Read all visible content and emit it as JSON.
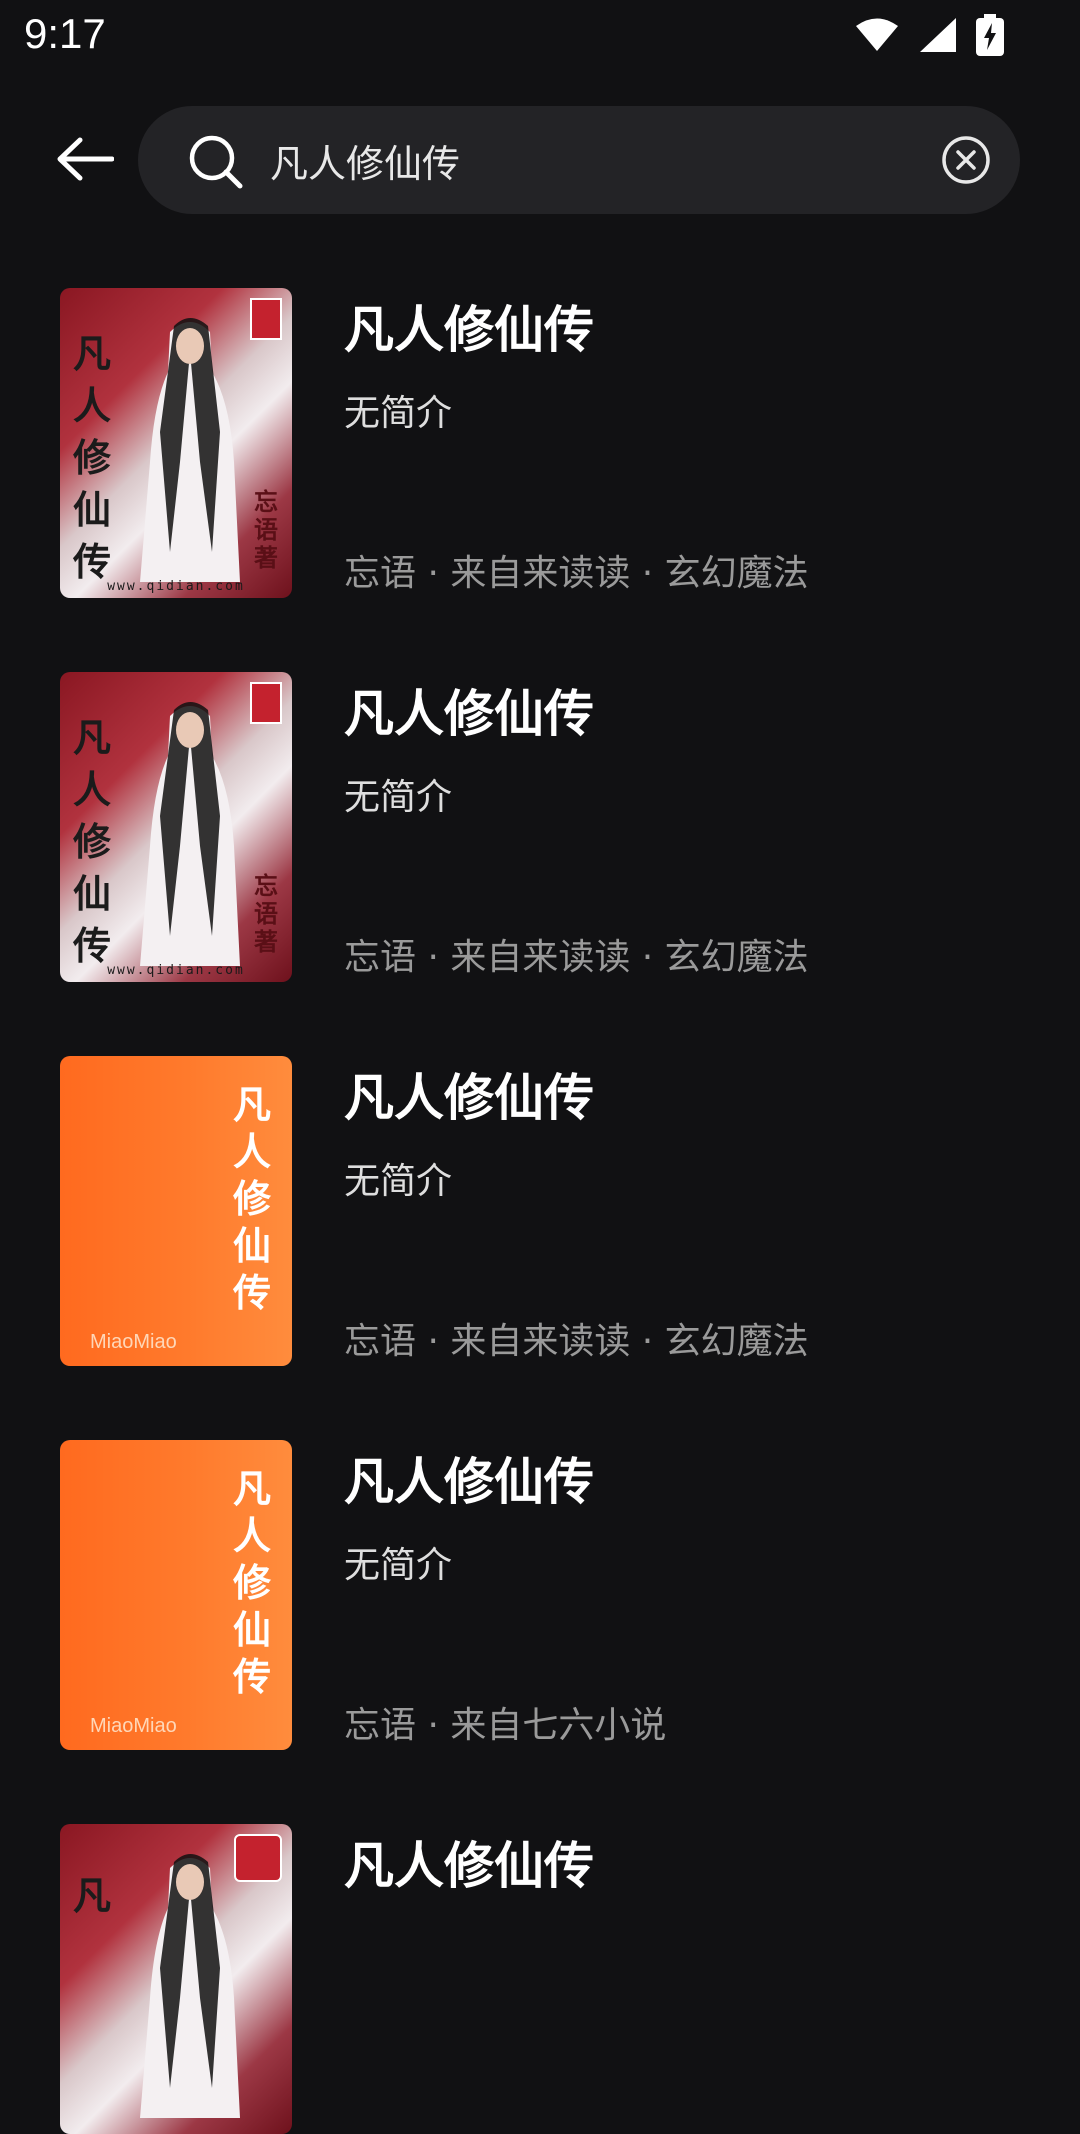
{
  "status_bar": {
    "time": "9:17",
    "icons": [
      "wifi-icon",
      "signal-icon",
      "battery-charging-icon"
    ]
  },
  "search": {
    "query": "凡人修仙传",
    "back_icon": "back-arrow-icon",
    "search_icon": "search-icon",
    "clear_icon": "clear-icon"
  },
  "results": [
    {
      "title": "凡人修仙传",
      "intro": "无简介",
      "meta": "忘语 · 来自来读读 · 玄幻魔法",
      "cover": {
        "style": "portrait",
        "vertical_title": "凡\n人\n修\n仙\n传",
        "author_stamp": "忘语著",
        "url": "www.qidian.com"
      }
    },
    {
      "title": "凡人修仙传",
      "intro": "无简介",
      "meta": "忘语 · 来自来读读 · 玄幻魔法",
      "cover": {
        "style": "portrait",
        "vertical_title": "凡\n人\n修\n仙\n传",
        "author_stamp": "忘语著",
        "url": "www.qidian.com"
      }
    },
    {
      "title": "凡人修仙传",
      "intro": "无简介",
      "meta": "忘语 · 来自来读读 · 玄幻魔法",
      "cover": {
        "style": "orange",
        "vertical_title": "凡\n人\n修\n仙\n传",
        "brand": "MiaoMiao"
      }
    },
    {
      "title": "凡人修仙传",
      "intro": "无简介",
      "meta": "忘语 · 来自七六小说",
      "cover": {
        "style": "orange",
        "vertical_title": "凡\n人\n修\n仙\n传",
        "brand": "MiaoMiao"
      }
    },
    {
      "title": "凡人修仙传",
      "intro": "",
      "meta": "",
      "cover": {
        "style": "portrait",
        "vertical_title": "凡",
        "author_stamp": "",
        "url": ""
      }
    }
  ],
  "colors": {
    "background": "#111113",
    "search_box": "#232326",
    "title": "#ffffff",
    "meta": "#9a9a9a",
    "orange_cover": "#ff6a1f"
  }
}
